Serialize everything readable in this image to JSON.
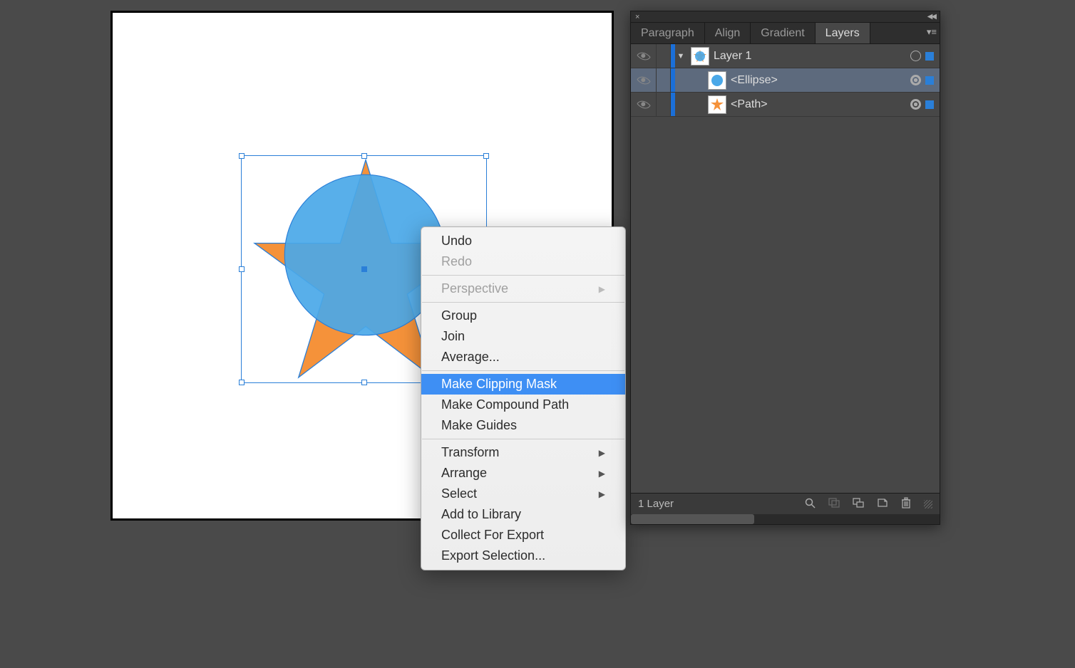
{
  "colors": {
    "star_fill": "#f5923a",
    "ellipse_fill": "#4aa8e8",
    "selection": "#2a7fd8"
  },
  "context_menu": {
    "items": [
      {
        "label": "Undo",
        "disabled": false
      },
      {
        "label": "Redo",
        "disabled": true
      },
      {
        "sep": true
      },
      {
        "label": "Perspective",
        "disabled": true,
        "submenu": true
      },
      {
        "sep": true
      },
      {
        "label": "Group",
        "disabled": false
      },
      {
        "label": "Join",
        "disabled": false
      },
      {
        "label": "Average...",
        "disabled": false
      },
      {
        "sep": true
      },
      {
        "label": "Make Clipping Mask",
        "disabled": false,
        "highlighted": true
      },
      {
        "label": "Make Compound Path",
        "disabled": false
      },
      {
        "label": "Make Guides",
        "disabled": false
      },
      {
        "sep": true
      },
      {
        "label": "Transform",
        "disabled": false,
        "submenu": true
      },
      {
        "label": "Arrange",
        "disabled": false,
        "submenu": true
      },
      {
        "label": "Select",
        "disabled": false,
        "submenu": true
      },
      {
        "label": "Add to Library",
        "disabled": false
      },
      {
        "label": "Collect For Export",
        "disabled": false
      },
      {
        "label": "Export Selection...",
        "disabled": false
      }
    ]
  },
  "panel": {
    "tabs": [
      "Paragraph",
      "Align",
      "Gradient",
      "Layers"
    ],
    "active_tab": "Layers",
    "layers": {
      "parent": {
        "name": "Layer 1"
      },
      "children": [
        {
          "name": "<Ellipse>",
          "selected_row": true
        },
        {
          "name": "<Path>",
          "selected_row": false
        }
      ]
    },
    "footer_text": "1 Layer"
  }
}
